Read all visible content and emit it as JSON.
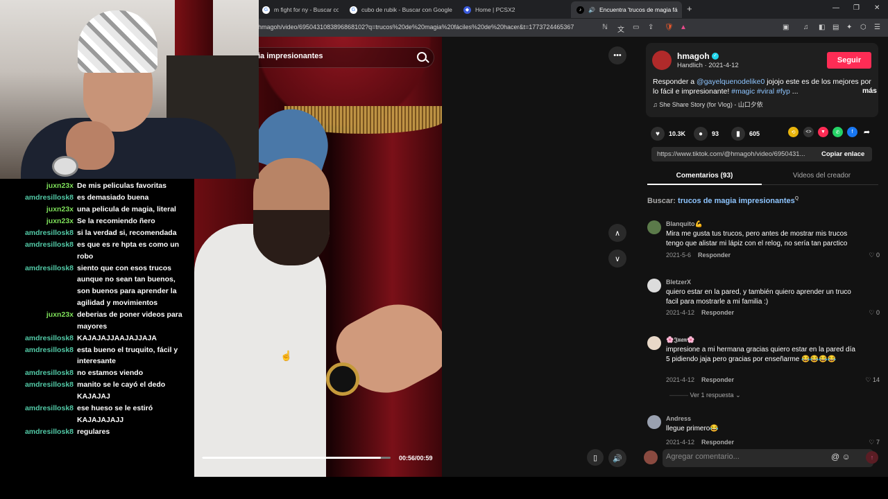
{
  "browser": {
    "tabs": [
      {
        "label": "m fight for ny - Buscar con Goo",
        "icon": "google-icon"
      },
      {
        "label": "cubo de rubik - Buscar con Google",
        "icon": "google-icon"
      },
      {
        "label": "Home | PCSX2",
        "icon": "pcsx2-icon"
      },
      {
        "label": "Encuentra 'trucos de magia fá",
        "icon": "tiktok-icon"
      }
    ],
    "url": "hmagoh/video/6950431083896868102?q=trucos%20de%20magia%20fáciles%20de%20hacer&t=1773724465367"
  },
  "video": {
    "search_text": "ia impresionantes",
    "time": "00:56/00:59",
    "progress": 0.95
  },
  "chat": [
    {
      "user": "juxn23x",
      "color": "#7ee05a",
      "msg": "De mis peliculas favoritas"
    },
    {
      "user": "amdresillosk8",
      "color": "#52c9a6",
      "msg": "es demasiado buena"
    },
    {
      "user": "juxn23x",
      "color": "#7ee05a",
      "msg": "una pelicula de magia, literal"
    },
    {
      "user": "juxn23x",
      "color": "#7ee05a",
      "msg": "Se la recomiendo ñero"
    },
    {
      "user": "amdresillosk8",
      "color": "#52c9a6",
      "msg": "si la verdad si, recomendada"
    },
    {
      "user": "amdresillosk8",
      "color": "#52c9a6",
      "msg": "es que es re hpta es como un robo"
    },
    {
      "user": "amdresillosk8",
      "color": "#52c9a6",
      "msg": "siento que con esos trucos aunque no sean tan buenos, son buenos para aprender la agilidad y movimientos"
    },
    {
      "user": "juxn23x",
      "color": "#7ee05a",
      "msg": "deberias de poner videos para mayores"
    },
    {
      "user": "amdresillosk8",
      "color": "#52c9a6",
      "msg": "KAJAJAJJAAJAJJAJA"
    },
    {
      "user": "amdresillosk8",
      "color": "#52c9a6",
      "msg": "esta bueno el truquito, fácil y interesante"
    },
    {
      "user": "amdresillosk8",
      "color": "#52c9a6",
      "msg": "no estamos viendo"
    },
    {
      "user": "amdresillosk8",
      "color": "#52c9a6",
      "msg": "manito se le cayó el dedo KAJAJAJ"
    },
    {
      "user": "amdresillosk8",
      "color": "#52c9a6",
      "msg": "ese hueso se le estiró KAJAJAJAJJ"
    },
    {
      "user": "amdresillosk8",
      "color": "#52c9a6",
      "msg": "regulares"
    }
  ],
  "post": {
    "username": "hmagoh",
    "subtitle": "Handlich · 2021-4-12",
    "follow_label": "Seguir",
    "desc_prefix": "Responder a ",
    "desc_mention": "@gayelquenodelike0",
    "desc_body": " jojojo este es de los mejores por lo fácil e impresionante! ",
    "desc_tags": "#magic #viral #fyp",
    "desc_ellipsis": " ...",
    "more_label": "más",
    "music": "She Share Story (for Vlog) - 山口夕依",
    "likes": "10.3K",
    "comments_count": "93",
    "saves": "605",
    "link": "https://www.tiktok.com/@hmagoh/video/6950431...",
    "copy_label": "Copiar enlace",
    "tab_comments": "Comentarios (93)",
    "tab_videos": "Videos del creador",
    "search_prefix": "Buscar:",
    "search_term": "trucos de magia impresionantes"
  },
  "comments": [
    {
      "name": "Blanquito💪",
      "text": "Mira me gusta tus trucos, pero antes de mostrar mis trucos tengo que alistar mi lápiz con el relog, no sería tan parctico",
      "date": "2021-5-6",
      "reply": "Responder",
      "likes": "0"
    },
    {
      "name": "BletzerX",
      "text": "quiero estar en la pared, y también quiero aprender un truco facil para mostrarle a mi familia :)",
      "date": "2021-4-12",
      "reply": "Responder",
      "likes": "0"
    },
    {
      "name": "🌸𝕵𝖚𝖆𝖓🌸",
      "text": "impresione a mi hermana gracias quiero estar en la pared día 5 pidiendo jaja pero gracias por enseñarme 😂😂😂😂",
      "date": "2021-4-12",
      "reply": "Responder",
      "likes": "14"
    },
    {
      "name": "Andress",
      "text": "llegue primero😂",
      "date": "2021-4-12",
      "reply": "Responder",
      "likes": "7"
    }
  ],
  "replies_label": "Ver 1 respuesta",
  "comment_placeholder": "Agregar comentario..."
}
